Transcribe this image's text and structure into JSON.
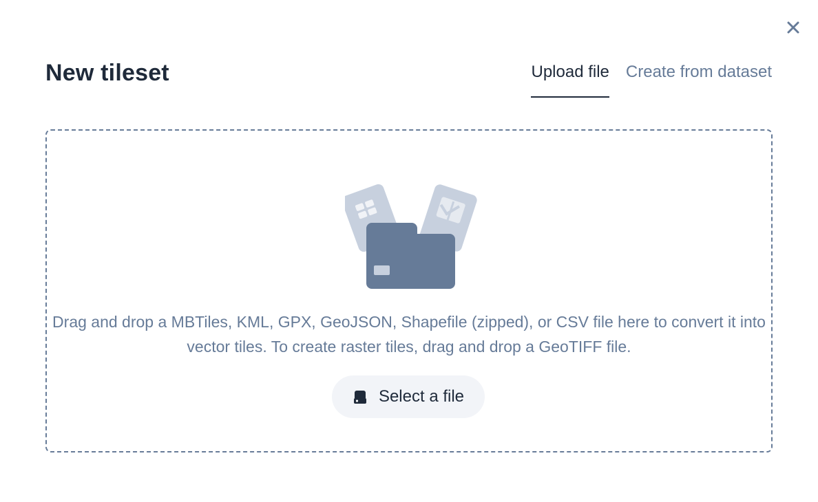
{
  "dialog": {
    "title": "New tileset",
    "close_icon": "close-icon"
  },
  "tabs": [
    {
      "label": "Upload file",
      "active": true
    },
    {
      "label": "Create from dataset",
      "active": false
    }
  ],
  "dropzone": {
    "illustration_icon": "folder-with-files-icon",
    "description": "Drag and drop a MBTiles, KML, GPX, GeoJSON, Shapefile (zipped), or CSV file here to convert it into vector tiles. To create raster tiles, drag and drop a GeoTIFF file.",
    "select_button_label": "Select a file",
    "select_button_icon": "hard-drive-icon"
  },
  "colors": {
    "heading": "#1f2a3a",
    "muted": "#667b98",
    "button_bg": "#f2f4f8",
    "illustration_light": "#c7d0de",
    "illustration_dark": "#667b98"
  }
}
